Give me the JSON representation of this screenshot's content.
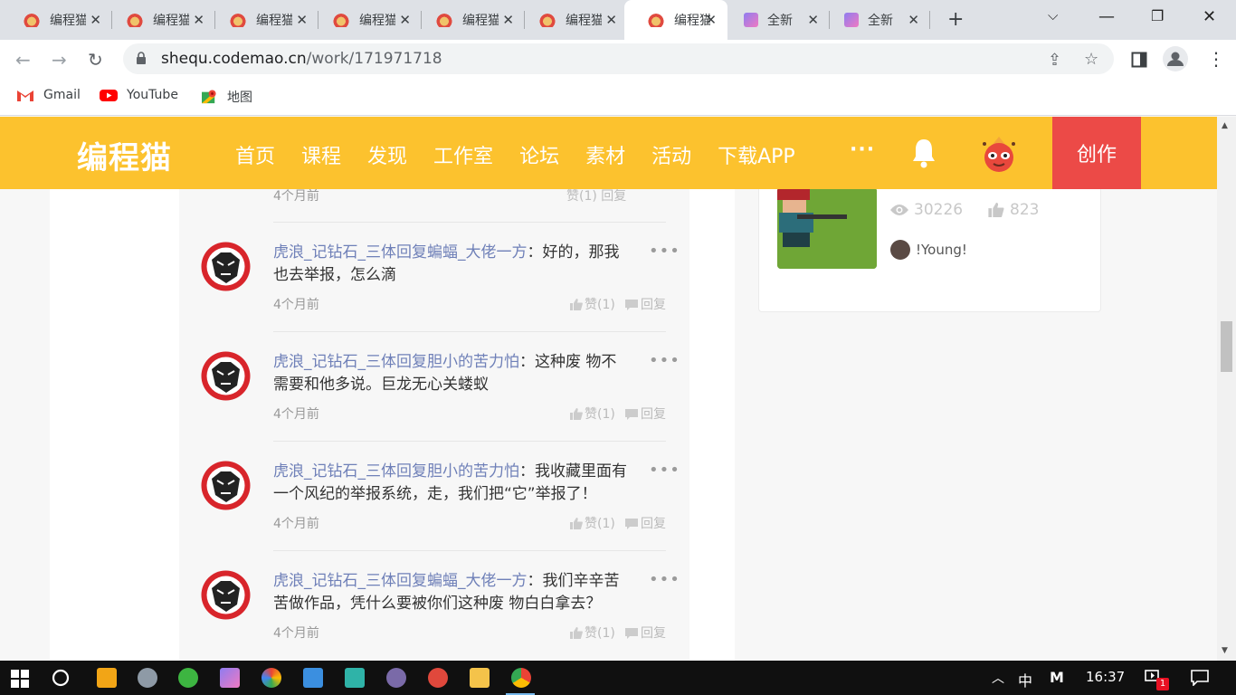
{
  "browser": {
    "tabs": [
      {
        "title": "编程猫",
        "icon": "codemao-cat-icon"
      },
      {
        "title": "编程猫",
        "icon": "codemao-cat-icon"
      },
      {
        "title": "编程猫",
        "icon": "codemao-cat-icon"
      },
      {
        "title": "编程猫",
        "icon": "codemao-cat-icon"
      },
      {
        "title": "编程猫",
        "icon": "codemao-cat-icon"
      },
      {
        "title": "编程猫",
        "icon": "codemao-cat-icon"
      },
      {
        "title": "编程猫",
        "icon": "codemao-cat-icon",
        "active": true
      },
      {
        "title": "全新",
        "icon": "kitten-editor-icon"
      },
      {
        "title": "全新",
        "icon": "kitten-editor-icon"
      }
    ],
    "url_domain": "shequ.codemao.cn",
    "url_path": "/work/171971718",
    "bookmarks": [
      {
        "label": "Gmail",
        "icon": "gmail-icon"
      },
      {
        "label": "YouTube",
        "icon": "youtube-icon"
      },
      {
        "label": "地图",
        "icon": "maps-icon"
      }
    ]
  },
  "site": {
    "logo": "编程猫",
    "nav": [
      "首页",
      "课程",
      "发现",
      "工作室",
      "论坛",
      "素材",
      "活动",
      "下载APP"
    ],
    "more": "···",
    "create": "创作",
    "brand_color": "#fcc22e",
    "create_color": "#ec4a47"
  },
  "comments": {
    "top_time": "4个月前",
    "top_actions": "赞(1) 回复",
    "items": [
      {
        "author": "虎浪_记钻石_三体回复蝙蝠_大佬一方",
        "text": "：好的，那我也去举报，怎么滴",
        "time": "4个月前",
        "like": "赞(1)",
        "reply": "回复"
      },
      {
        "author": "虎浪_记钻石_三体回复胆小的苦力怕",
        "text": "：这种废 物不需要和他多说。巨龙无心关蝼蚁",
        "time": "4个月前",
        "like": "赞(1)",
        "reply": "回复"
      },
      {
        "author": "虎浪_记钻石_三体回复胆小的苦力怕",
        "text": "：我收藏里面有一个风纪的举报系统，走，我们把“它”举报了！",
        "time": "4个月前",
        "like": "赞(1)",
        "reply": "回复"
      },
      {
        "author": "虎浪_记钻石_三体回复蝙蝠_大佬一方",
        "text": "：我们辛辛苦苦做作品，凭什么要被你们这种废 物白白拿去？",
        "time": "4个月前",
        "like": "赞(1)",
        "reply": "回复"
      }
    ],
    "author_color": "#6f80b8"
  },
  "related_work": {
    "views": "30226",
    "likes": "823",
    "author": "!Young!"
  },
  "taskbar": {
    "ime": "中",
    "time": "16:37",
    "notification_count": "1"
  }
}
